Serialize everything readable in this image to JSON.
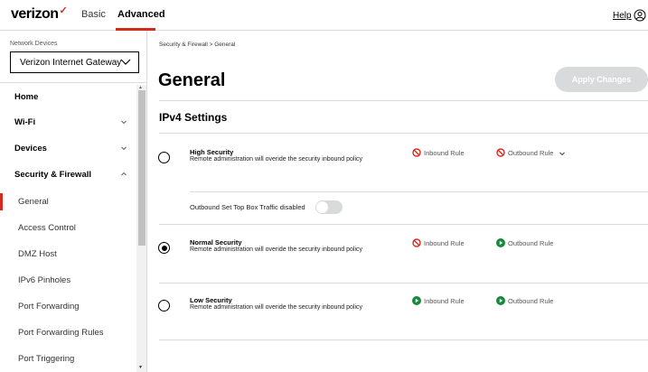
{
  "header": {
    "logo_text": "verizon",
    "logo_check": "✓",
    "tabs": [
      {
        "label": "Basic"
      },
      {
        "label": "Advanced"
      }
    ],
    "help_label": "Help",
    "user_icon": "user-circle-icon"
  },
  "sidebar": {
    "devices_label": "Network Devices",
    "device_selected": "Verizon Internet Gateway",
    "items": [
      {
        "label": "Home"
      },
      {
        "label": "Wi-Fi"
      },
      {
        "label": "Devices"
      },
      {
        "label": "Security & Firewall"
      },
      {
        "label": "General"
      },
      {
        "label": "Access Control"
      },
      {
        "label": "DMZ Host"
      },
      {
        "label": "IPv6 Pinholes"
      },
      {
        "label": "Port Forwarding"
      },
      {
        "label": "Port Forwarding Rules"
      },
      {
        "label": "Port Triggering"
      }
    ]
  },
  "main": {
    "breadcrumb": "Security & Firewall  >  General",
    "title": "General",
    "apply_label": "Apply Changes",
    "section_title": "IPv4 Settings",
    "options": [
      {
        "title": "High Security",
        "desc": "Remote administration will overide the security inbound policy",
        "inbound": "Inbound Rule",
        "outbound": "Outbound Rule",
        "inbound_state": "blocked",
        "outbound_state": "blocked",
        "selected": false
      },
      {
        "title": "Normal Security",
        "desc": "Remote administration will overide the security inbound policy",
        "inbound": "Inbound Rule",
        "outbound": "Outbound Rule",
        "inbound_state": "blocked",
        "outbound_state": "allowed",
        "selected": true
      },
      {
        "title": "Low Security",
        "desc": "Remote administration will overide the security inbound policy",
        "inbound": "Inbound Rule",
        "outbound": "Outbound Rule",
        "inbound_state": "allowed",
        "outbound_state": "allowed",
        "selected": false
      }
    ],
    "stb_toggle_label": "Outbound Set Top Box Traffic disabled",
    "stb_toggle_on": false
  },
  "colors": {
    "brand_red": "#d52b1e",
    "allowed_green": "#168a3b",
    "blocked_red": "#d52b1e",
    "disabled_gray": "#d8dadb"
  }
}
